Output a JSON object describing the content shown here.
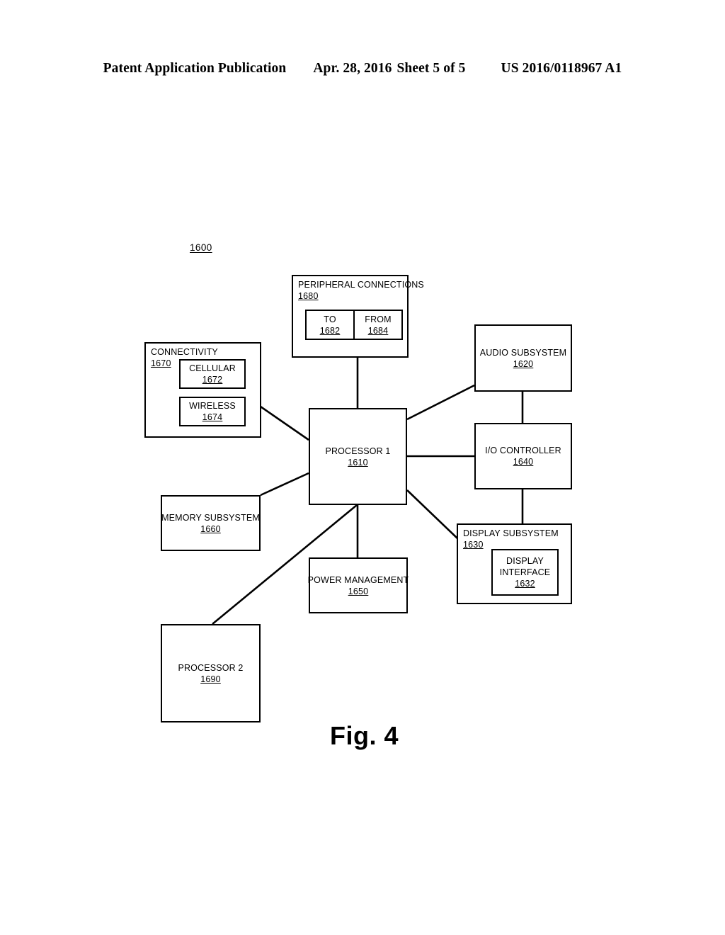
{
  "header": {
    "publication": "Patent Application Publication",
    "date": "Apr. 28, 2016",
    "sheet": "Sheet 5 of 5",
    "patent_number": "US 2016/0118967 A1"
  },
  "figure": {
    "caption": "Fig. 4",
    "system_ref": "1600"
  },
  "blocks": {
    "peripheral_connections": {
      "label": "PERIPHERAL CONNECTIONS",
      "ref": "1680",
      "children": {
        "to": {
          "label": "TO",
          "ref": "1682"
        },
        "from": {
          "label": "FROM",
          "ref": "1684"
        }
      }
    },
    "connectivity": {
      "label": "CONNECTIVITY",
      "ref": "1670",
      "children": {
        "cellular": {
          "label": "CELLULAR",
          "ref": "1672"
        },
        "wireless": {
          "label": "WIRELESS",
          "ref": "1674"
        }
      }
    },
    "processor_1": {
      "label": "PROCESSOR 1",
      "ref": "1610"
    },
    "processor_2": {
      "label": "PROCESSOR 2",
      "ref": "1690"
    },
    "audio_subsystem": {
      "label": "AUDIO SUBSYSTEM",
      "ref": "1620"
    },
    "io_controller": {
      "label": "I/O CONTROLLER",
      "ref": "1640"
    },
    "display_subsystem": {
      "label": "DISPLAY SUBSYSTEM",
      "ref": "1630",
      "children": {
        "display_interface": {
          "label_line1": "DISPLAY",
          "label_line2": "INTERFACE",
          "ref": "1632"
        }
      }
    },
    "memory_subsystem": {
      "label": "MEMORY SUBSYSTEM",
      "ref": "1660"
    },
    "power_management": {
      "label": "POWER MANAGEMENT",
      "ref": "1650"
    }
  },
  "connections": [
    {
      "from": "peripheral_connections",
      "to": "processor_1"
    },
    {
      "from": "connectivity",
      "to": "processor_1"
    },
    {
      "from": "memory_subsystem",
      "to": "processor_1"
    },
    {
      "from": "processor_1",
      "to": "processor_2"
    },
    {
      "from": "processor_1",
      "to": "power_management"
    },
    {
      "from": "processor_1",
      "to": "audio_subsystem"
    },
    {
      "from": "processor_1",
      "to": "io_controller"
    },
    {
      "from": "processor_1",
      "to": "display_subsystem"
    },
    {
      "from": "audio_subsystem",
      "to": "io_controller"
    },
    {
      "from": "io_controller",
      "to": "display_subsystem"
    }
  ],
  "style": {
    "line_color": "#000000",
    "background": "#ffffff"
  }
}
